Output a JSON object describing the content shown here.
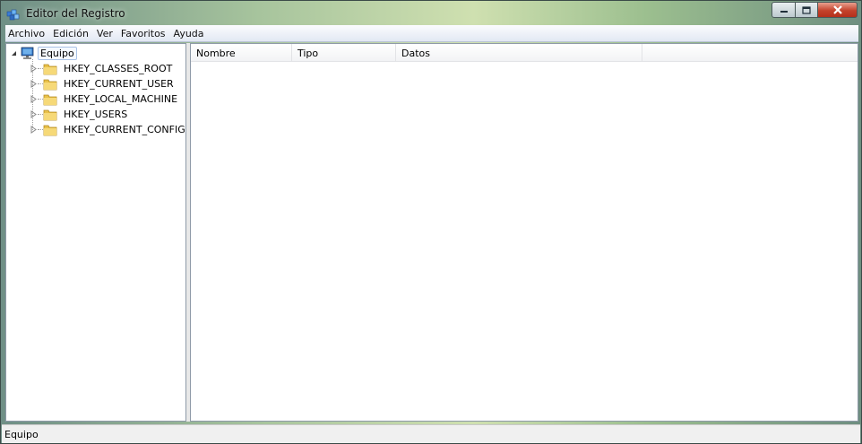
{
  "window": {
    "title": "Editor del Registro",
    "controls": {
      "minimize": "minimize",
      "maximize": "maximize",
      "close": "close"
    }
  },
  "menu": [
    "Archivo",
    "Edición",
    "Ver",
    "Favoritos",
    "Ayuda"
  ],
  "tree": {
    "root": {
      "label": "Equipo",
      "icon": "computer-icon",
      "expanded": true,
      "selected": true
    },
    "keys": [
      {
        "label": "HKEY_CLASSES_ROOT",
        "icon": "folder-icon"
      },
      {
        "label": "HKEY_CURRENT_USER",
        "icon": "folder-icon"
      },
      {
        "label": "HKEY_LOCAL_MACHINE",
        "icon": "folder-icon"
      },
      {
        "label": "HKEY_USERS",
        "icon": "folder-icon"
      },
      {
        "label": "HKEY_CURRENT_CONFIG",
        "icon": "folder-icon"
      }
    ]
  },
  "list": {
    "columns": [
      "Nombre",
      "Tipo",
      "Datos"
    ],
    "rows": []
  },
  "status": {
    "text": "Equipo"
  },
  "colors": {
    "selection_border": "#a9c2e6",
    "close_button": "#c4422b"
  }
}
